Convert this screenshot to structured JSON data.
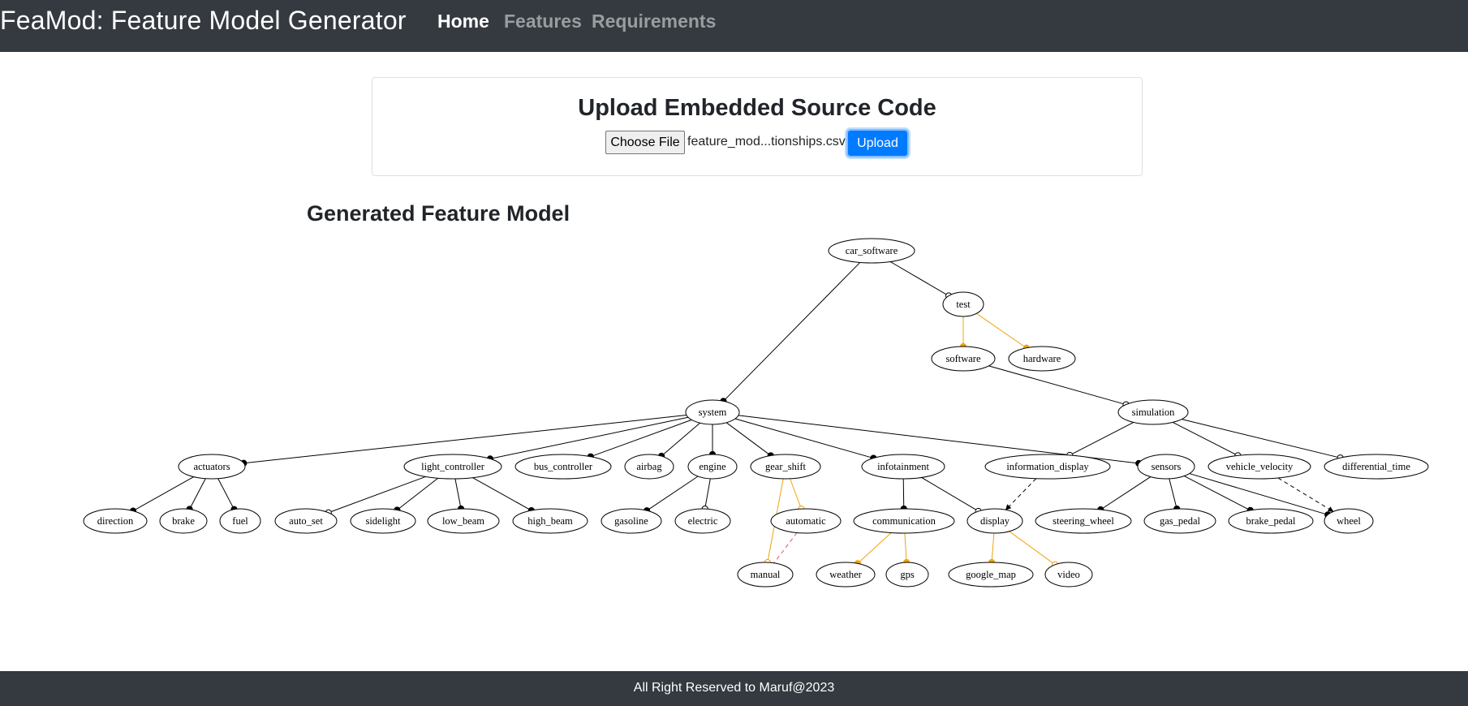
{
  "navbar": {
    "brand": "FeaMod: Feature Model Generator",
    "links": [
      {
        "label": "Home",
        "active": true
      },
      {
        "label": "Features",
        "active": false
      },
      {
        "label": "Requirements",
        "active": false
      }
    ]
  },
  "upload": {
    "title": "Upload Embedded Source Code",
    "choose_file_label": "Choose File",
    "file_name": "feature_mod...tionships.csv",
    "upload_label": "Upload"
  },
  "model": {
    "title": "Generated Feature Model",
    "colors": {
      "edge": "#000000",
      "group": "#f0a30a",
      "requires": "#000000",
      "excludes": "#e0507a"
    },
    "nodes": [
      {
        "id": "car_software",
        "label": "car_software"
      },
      {
        "id": "test",
        "label": "test"
      },
      {
        "id": "software",
        "label": "software"
      },
      {
        "id": "hardware",
        "label": "hardware"
      },
      {
        "id": "system",
        "label": "system"
      },
      {
        "id": "simulation",
        "label": "simulation"
      },
      {
        "id": "actuators",
        "label": "actuators"
      },
      {
        "id": "light_controller",
        "label": "light_controller"
      },
      {
        "id": "bus_controller",
        "label": "bus_controller"
      },
      {
        "id": "airbag",
        "label": "airbag"
      },
      {
        "id": "engine",
        "label": "engine"
      },
      {
        "id": "gear_shift",
        "label": "gear_shift"
      },
      {
        "id": "infotainment",
        "label": "infotainment"
      },
      {
        "id": "information_display",
        "label": "information_display"
      },
      {
        "id": "sensors",
        "label": "sensors"
      },
      {
        "id": "vehicle_velocity",
        "label": "vehicle_velocity"
      },
      {
        "id": "differential_time",
        "label": "differential_time"
      },
      {
        "id": "direction",
        "label": "direction"
      },
      {
        "id": "brake",
        "label": "brake"
      },
      {
        "id": "fuel",
        "label": "fuel"
      },
      {
        "id": "auto_set",
        "label": "auto_set"
      },
      {
        "id": "sidelight",
        "label": "sidelight"
      },
      {
        "id": "low_beam",
        "label": "low_beam"
      },
      {
        "id": "high_beam",
        "label": "high_beam"
      },
      {
        "id": "gasoline",
        "label": "gasoline"
      },
      {
        "id": "electric",
        "label": "electric"
      },
      {
        "id": "automatic",
        "label": "automatic"
      },
      {
        "id": "communication",
        "label": "communication"
      },
      {
        "id": "display",
        "label": "display"
      },
      {
        "id": "steering_wheel",
        "label": "steering_wheel"
      },
      {
        "id": "gas_pedal",
        "label": "gas_pedal"
      },
      {
        "id": "brake_pedal",
        "label": "brake_pedal"
      },
      {
        "id": "wheel",
        "label": "wheel"
      },
      {
        "id": "manual",
        "label": "manual"
      },
      {
        "id": "weather",
        "label": "weather"
      },
      {
        "id": "gps",
        "label": "gps"
      },
      {
        "id": "google_map",
        "label": "google_map"
      },
      {
        "id": "video",
        "label": "video"
      }
    ],
    "edges": [
      {
        "from": "car_software",
        "to": "system",
        "type": "mandatory"
      },
      {
        "from": "car_software",
        "to": "test",
        "type": "optional"
      },
      {
        "from": "test",
        "to": "software",
        "type": "alternative"
      },
      {
        "from": "test",
        "to": "hardware",
        "type": "alternative"
      },
      {
        "from": "software",
        "to": "simulation",
        "type": "optional"
      },
      {
        "from": "system",
        "to": "actuators",
        "type": "mandatory"
      },
      {
        "from": "system",
        "to": "light_controller",
        "type": "mandatory"
      },
      {
        "from": "system",
        "to": "bus_controller",
        "type": "mandatory"
      },
      {
        "from": "system",
        "to": "airbag",
        "type": "mandatory"
      },
      {
        "from": "system",
        "to": "engine",
        "type": "mandatory"
      },
      {
        "from": "system",
        "to": "gear_shift",
        "type": "mandatory"
      },
      {
        "from": "system",
        "to": "infotainment",
        "type": "mandatory"
      },
      {
        "from": "system",
        "to": "sensors",
        "type": "mandatory"
      },
      {
        "from": "simulation",
        "to": "information_display",
        "type": "optional"
      },
      {
        "from": "simulation",
        "to": "vehicle_velocity",
        "type": "optional"
      },
      {
        "from": "simulation",
        "to": "differential_time",
        "type": "optional"
      },
      {
        "from": "actuators",
        "to": "direction",
        "type": "mandatory"
      },
      {
        "from": "actuators",
        "to": "brake",
        "type": "mandatory"
      },
      {
        "from": "actuators",
        "to": "fuel",
        "type": "mandatory"
      },
      {
        "from": "light_controller",
        "to": "auto_set",
        "type": "optional"
      },
      {
        "from": "light_controller",
        "to": "sidelight",
        "type": "mandatory"
      },
      {
        "from": "light_controller",
        "to": "low_beam",
        "type": "mandatory"
      },
      {
        "from": "light_controller",
        "to": "high_beam",
        "type": "mandatory"
      },
      {
        "from": "engine",
        "to": "gasoline",
        "type": "mandatory"
      },
      {
        "from": "engine",
        "to": "electric",
        "type": "optional"
      },
      {
        "from": "gear_shift",
        "to": "automatic",
        "type": "or"
      },
      {
        "from": "gear_shift",
        "to": "manual",
        "type": "or"
      },
      {
        "from": "infotainment",
        "to": "communication",
        "type": "mandatory"
      },
      {
        "from": "infotainment",
        "to": "display",
        "type": "optional"
      },
      {
        "from": "sensors",
        "to": "steering_wheel",
        "type": "mandatory"
      },
      {
        "from": "sensors",
        "to": "gas_pedal",
        "type": "mandatory"
      },
      {
        "from": "sensors",
        "to": "brake_pedal",
        "type": "mandatory"
      },
      {
        "from": "sensors",
        "to": "wheel",
        "type": "mandatory"
      },
      {
        "from": "communication",
        "to": "weather",
        "type": "alternative"
      },
      {
        "from": "communication",
        "to": "gps",
        "type": "alternative"
      },
      {
        "from": "display",
        "to": "google_map",
        "type": "alternative"
      },
      {
        "from": "display",
        "to": "video",
        "type": "or"
      },
      {
        "from": "information_display",
        "to": "display",
        "type": "requires"
      },
      {
        "from": "vehicle_velocity",
        "to": "wheel",
        "type": "requires"
      },
      {
        "from": "automatic",
        "to": "manual",
        "type": "excludes"
      }
    ]
  },
  "footer": {
    "text": "All Right Reserved to Maruf@2023"
  }
}
